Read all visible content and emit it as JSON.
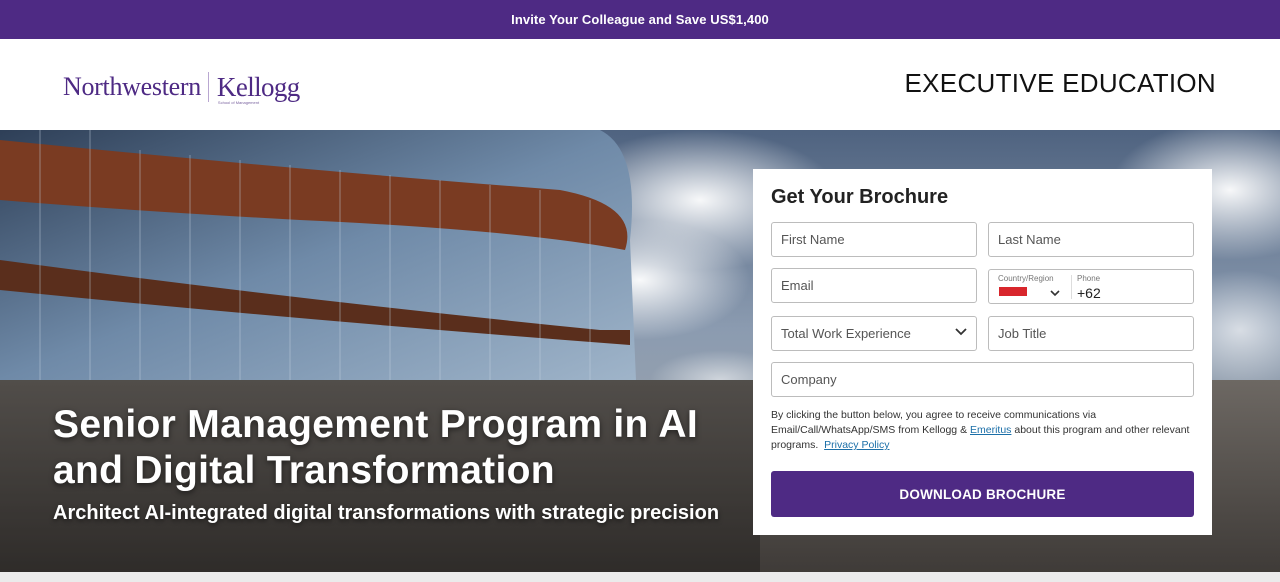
{
  "promo": {
    "text": "Invite Your Colleague and Save US$1,400"
  },
  "header": {
    "logo": {
      "northwestern": "Northwestern",
      "kellogg": "Kellogg",
      "school": "School of Management"
    },
    "tagline": "EXECUTIVE EDUCATION"
  },
  "hero": {
    "title_line1": "Senior Management Program in AI",
    "title_line2": "and Digital Transformation",
    "subtitle": "Architect AI-integrated digital transformations with strategic precision"
  },
  "form": {
    "title": "Get Your Brochure",
    "first_name_placeholder": "First Name",
    "last_name_placeholder": "Last Name",
    "email_placeholder": "Email",
    "country_label": "Country/Region",
    "phone_label": "Phone",
    "phone_code": "+62",
    "experience_select": "Total Work Experience",
    "job_title_placeholder": "Job Title",
    "company_placeholder": "Company",
    "consent_part1": "By clicking the button below, you agree to receive communications via Email/Call/WhatsApp/SMS from Kellogg & ",
    "consent_link1": "Emeritus",
    "consent_part2": " about this program and other relevant programs.",
    "consent_link2": "Privacy Policy",
    "button_label": "DOWNLOAD BROCHURE"
  },
  "colors": {
    "brand_purple": "#4e2a84",
    "flag_red": "#d8262c",
    "link_blue": "#1b6fa8"
  }
}
